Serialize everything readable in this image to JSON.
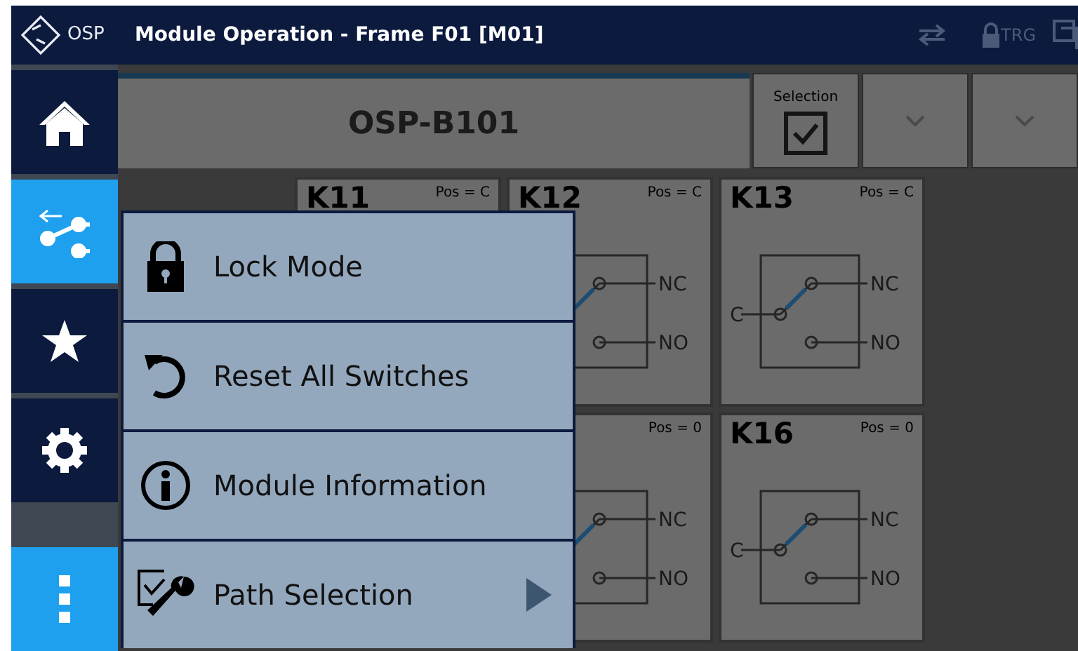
{
  "topbar": {
    "logo_text": "OSP",
    "title": "Module Operation - Frame F01 [M01]",
    "trigger_label": "TRG"
  },
  "sidebar": {
    "items": [
      {
        "kind": "home",
        "selected": false
      },
      {
        "kind": "switch",
        "selected": true
      },
      {
        "kind": "star",
        "selected": false
      },
      {
        "kind": "gear",
        "selected": false
      },
      {
        "kind": "more",
        "selected": true
      }
    ]
  },
  "module": {
    "title": "OSP-B101",
    "selection_label": "Selection",
    "selection_checked": true
  },
  "card_rows": [
    [
      {
        "title": "K11",
        "pos": "Pos = C"
      },
      {
        "title": "K12",
        "pos": "Pos = C",
        "nc": "NC",
        "no": "NO"
      },
      {
        "title": "K13",
        "pos": "Pos = C",
        "c": "C",
        "nc": "NC",
        "no": "NO"
      }
    ],
    [
      {
        "pos": "Pos = 0",
        "nc": "NC",
        "no": "NO"
      },
      {
        "title": "K16",
        "pos": "Pos = 0",
        "c": "C",
        "nc": "NC",
        "no": "NO"
      }
    ]
  ],
  "menu": {
    "items": [
      {
        "kind": "lock",
        "label": "Lock Mode"
      },
      {
        "kind": "reset",
        "label": "Reset All Switches"
      },
      {
        "kind": "info",
        "label": "Module Information"
      },
      {
        "kind": "path",
        "label": "Path Selection",
        "submenu": true
      }
    ]
  }
}
